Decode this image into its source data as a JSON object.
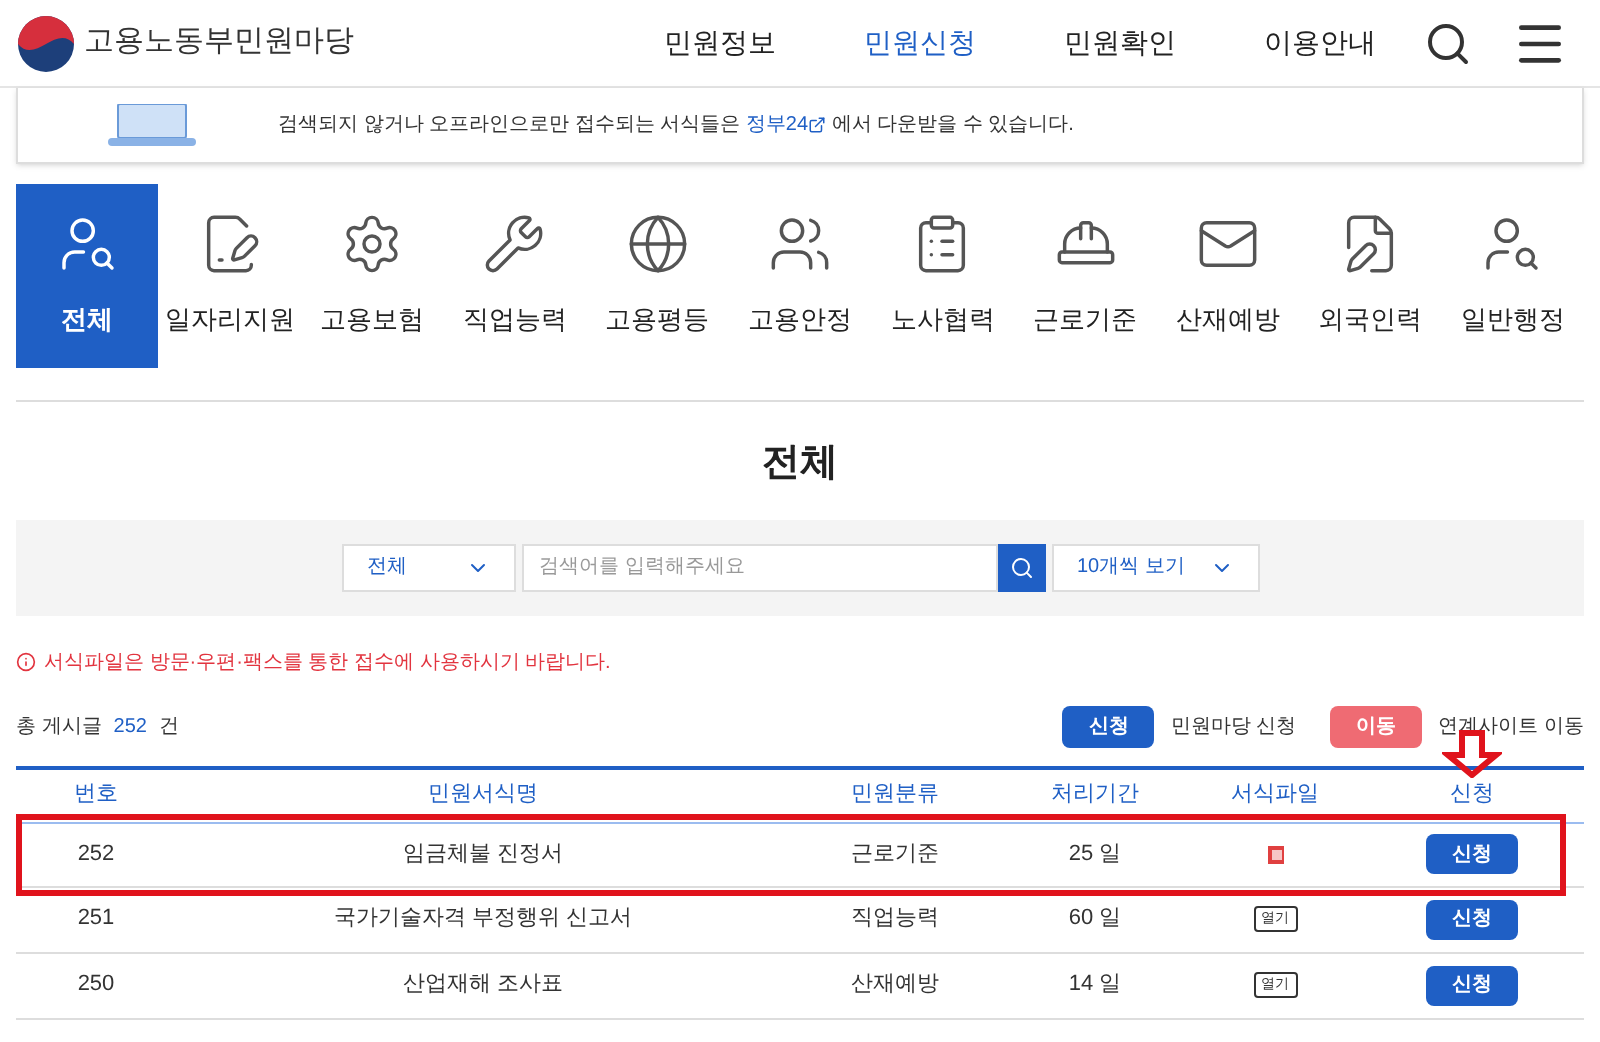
{
  "header": {
    "logo_text": "고용노동부민원마당",
    "nav": [
      {
        "label": "민원정보",
        "selected": false
      },
      {
        "label": "민원신청",
        "selected": true
      },
      {
        "label": "민원확인",
        "selected": false
      },
      {
        "label": "이용안내",
        "selected": false
      }
    ]
  },
  "notice": {
    "text_before": "검색되지 않거나 오프라인으로만 접수되는 서식들은",
    "link": "정부24",
    "text_after": "에서 다운받을 수 있습니다."
  },
  "categories": [
    {
      "label": "전체",
      "selected": true
    },
    {
      "label": "일자리지원",
      "selected": false
    },
    {
      "label": "고용보험",
      "selected": false
    },
    {
      "label": "직업능력",
      "selected": false
    },
    {
      "label": "고용평등",
      "selected": false
    },
    {
      "label": "고용안정",
      "selected": false
    },
    {
      "label": "노사협력",
      "selected": false
    },
    {
      "label": "근로기준",
      "selected": false
    },
    {
      "label": "산재예방",
      "selected": false
    },
    {
      "label": "외국인력",
      "selected": false
    },
    {
      "label": "일반행정",
      "selected": false
    }
  ],
  "section_title": "전체",
  "search": {
    "category": "전체",
    "placeholder": "검색어를 입력해주세요",
    "page_size": "10개씩 보기"
  },
  "warning": "서식파일은 방문·우편·팩스를 통한 접수에 사용하시기 바랍니다.",
  "total": {
    "label": "총 게시글",
    "count": "252",
    "unit": "건"
  },
  "legend": [
    {
      "badge": "신청",
      "text": "민원마당 신청",
      "color": "#1f5fc5"
    },
    {
      "badge": "이동",
      "text": "연계사이트 이동",
      "color": "#ef6b73"
    }
  ],
  "table": {
    "columns": [
      {
        "label": "번호",
        "annotated": false
      },
      {
        "label": "민원서식명",
        "annotated": false
      },
      {
        "label": "민원분류",
        "annotated": false
      },
      {
        "label": "처리기간",
        "annotated": false
      },
      {
        "label": "서식파일",
        "annotated": false
      },
      {
        "label": "신청",
        "annotated": true
      }
    ],
    "rows": [
      {
        "number": "252",
        "name": "임금체불 진정서",
        "category": "근로기준",
        "period": "25 일",
        "file": {
          "kind": "icon"
        },
        "action": "신청",
        "highlighted": true
      },
      {
        "number": "251",
        "name": "국가기술자격 부정행위 신고서",
        "category": "직업능력",
        "period": "60 일",
        "file": {
          "kind": "button",
          "label": "열기"
        },
        "action": "신청",
        "highlighted": false
      },
      {
        "number": "250",
        "name": "산업재해 조사표",
        "category": "산재예방",
        "period": "14 일",
        "file": {
          "kind": "button",
          "label": "열기"
        },
        "action": "신청",
        "highlighted": false
      }
    ]
  }
}
